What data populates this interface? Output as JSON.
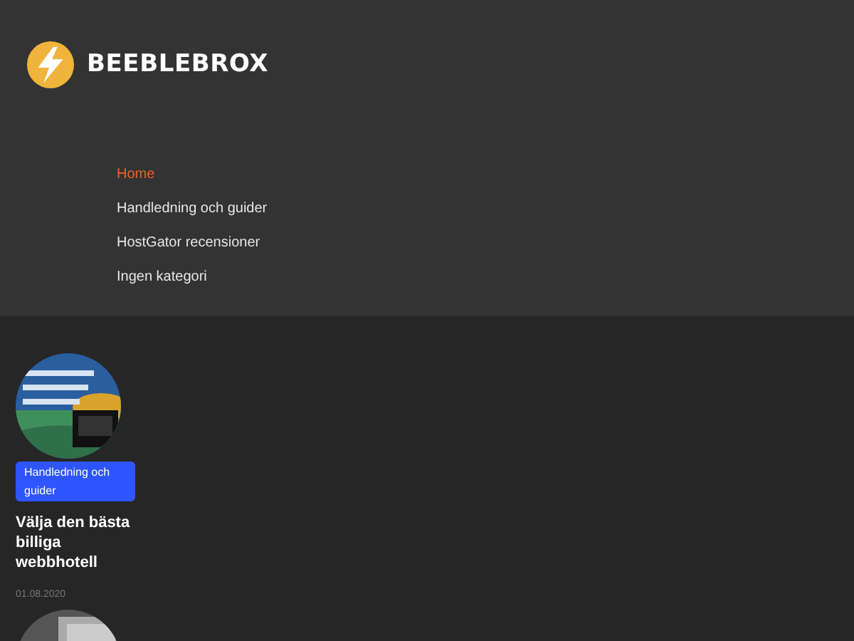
{
  "site": {
    "name": "BEEBLEBROX"
  },
  "menu": [
    {
      "label": "Home",
      "selected": true
    },
    {
      "label": "Handledning och guider",
      "selected": false
    },
    {
      "label": "HostGator recensioner",
      "selected": false
    },
    {
      "label": "Ingen kategori",
      "selected": false
    }
  ],
  "posts": [
    {
      "kind": "picture",
      "category": "Handledning och guider",
      "title": "Välja den bästa billiga webbhotell",
      "date": "01.08.2020"
    },
    {
      "kind": "picture"
    }
  ]
}
